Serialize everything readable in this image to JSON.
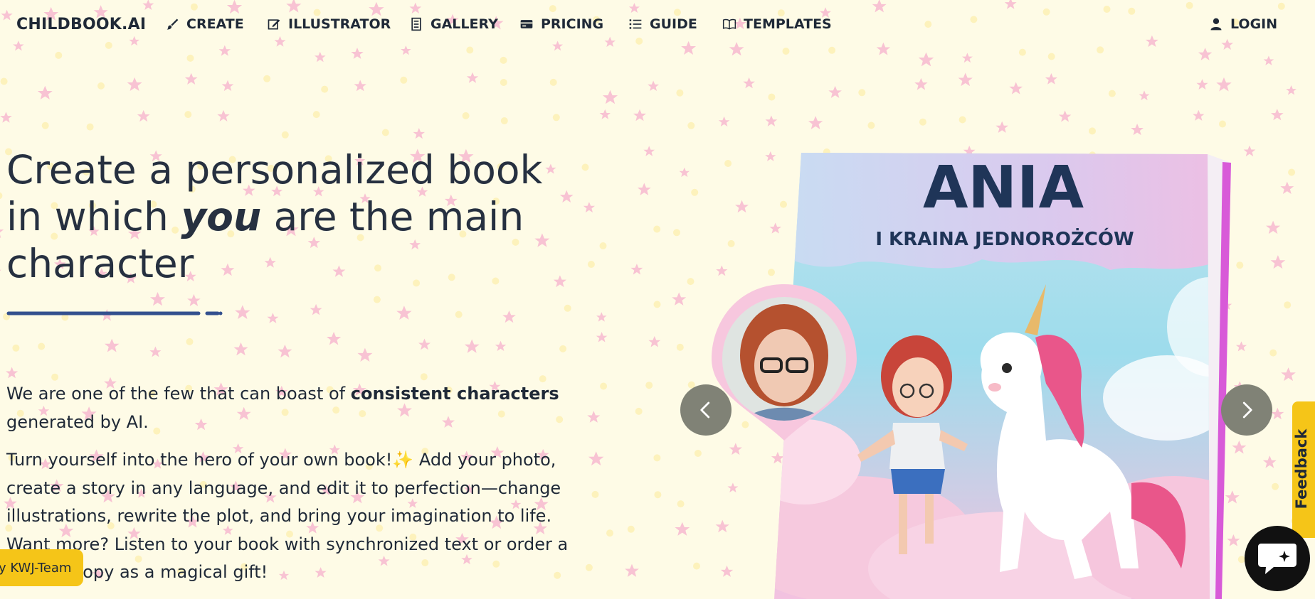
{
  "nav": {
    "brand": "CHILDBOOK.AI",
    "items": [
      {
        "label": "CREATE",
        "icon": "brush-icon"
      },
      {
        "label": "ILLUSTRATOR",
        "icon": "edit-icon"
      },
      {
        "label": "GALLERY",
        "icon": "gallery-icon"
      },
      {
        "label": "PRICING",
        "icon": "credit-card-icon"
      },
      {
        "label": "GUIDE",
        "icon": "list-icon"
      },
      {
        "label": "TEMPLATES",
        "icon": "book-open-icon"
      }
    ],
    "login": {
      "label": "LOGIN",
      "icon": "user-icon"
    }
  },
  "hero": {
    "title_before": "Create a personalized book in which ",
    "title_em": "you",
    "title_after": " are the main character",
    "p1_before": "We are one of the few that can boast of ",
    "p1_bold": "consistent characters",
    "p1_after": " generated by AI.",
    "p2": "Turn yourself into the hero of your own book!✨  Add your photo, create a story in any language, and edit it to perfection—change illustrations, rewrite the plot, and bring your imagination to life. Want more? Listen to your book with synchronized text or order a printed copy as a magical gift!"
  },
  "book": {
    "title": "ANIA",
    "subtitle": "I KRAINA JEDNOROŻCÓW"
  },
  "widgets": {
    "feedback": "Feedback",
    "badge": "y KWJ-Team"
  },
  "colors": {
    "background": "#fefbe6",
    "text": "#1f2937",
    "accent": "#33508e",
    "star": "#f7b8cf",
    "feedback": "#f5c518",
    "carousel_button": "#808276"
  }
}
